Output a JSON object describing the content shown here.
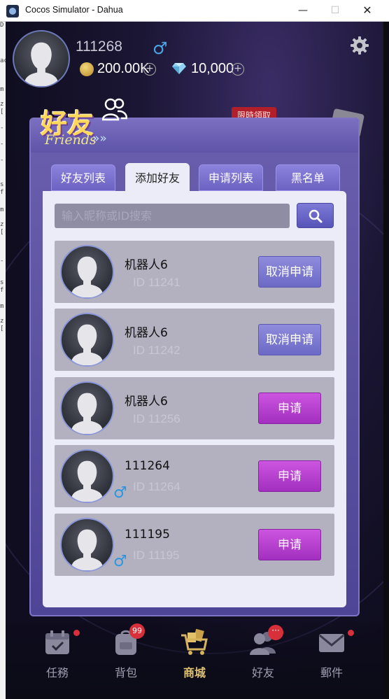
{
  "window": {
    "title": "Cocos Simulator - Dahua",
    "minimize": "—",
    "maximize": "☐",
    "close": "✕"
  },
  "console_lines": [
    "D",
    "ac",
    "m",
    "z",
    "[",
    "-",
    "-",
    "-",
    "s",
    "f",
    "m",
    "z",
    "[",
    "-",
    "s",
    "f",
    "m",
    "z",
    "["
  ],
  "player": {
    "id": "111268",
    "gender_symbol": "♂",
    "gold": "200.00K",
    "gems": "10,000",
    "plus": "+"
  },
  "promo": {
    "tag": "限時領取"
  },
  "friends_panel": {
    "title_cn": "好友",
    "title_en": "Friends",
    "title_arrows": "»»",
    "tabs": [
      {
        "label": "好友列表",
        "active": false
      },
      {
        "label": "添加好友",
        "active": true
      },
      {
        "label": "申请列表",
        "active": false
      },
      {
        "label": "黑名单",
        "active": false
      }
    ],
    "search": {
      "placeholder": "输入昵称或ID搜索",
      "value": ""
    },
    "rows": [
      {
        "name": "机器人6",
        "id_text": "ID  11241",
        "button": "取消申请",
        "status": "cancel",
        "gender": ""
      },
      {
        "name": "机器人6",
        "id_text": "ID  11242",
        "button": "取消申请",
        "status": "cancel",
        "gender": ""
      },
      {
        "name": "机器人6",
        "id_text": "ID  11256",
        "button": "申请",
        "status": "apply",
        "gender": ""
      },
      {
        "name": "111264",
        "id_text": "ID  11264",
        "button": "申请",
        "status": "apply",
        "gender": "♂"
      },
      {
        "name": "111195",
        "id_text": "ID  11195",
        "button": "申请",
        "status": "apply",
        "gender": "♂"
      }
    ]
  },
  "bottom_nav": [
    {
      "label": "任務",
      "icon": "calendar-check-icon",
      "active": false,
      "badge": "dot"
    },
    {
      "label": "背包",
      "icon": "backpack-icon",
      "active": false,
      "badge": "99"
    },
    {
      "label": "商城",
      "icon": "shopping-cart-icon",
      "active": true,
      "badge": ""
    },
    {
      "label": "好友",
      "icon": "friends-icon",
      "active": false,
      "badge": "···"
    },
    {
      "label": "郵件",
      "icon": "mail-icon",
      "active": false,
      "badge": "dot"
    }
  ],
  "colors": {
    "panel": "#5e54a8",
    "content_bg": "#ecebf8",
    "cancel_button": "#7b78d0",
    "apply_button": "#b23fcf",
    "male_blue": "#2c95df",
    "active_nav": "#e0c270"
  }
}
